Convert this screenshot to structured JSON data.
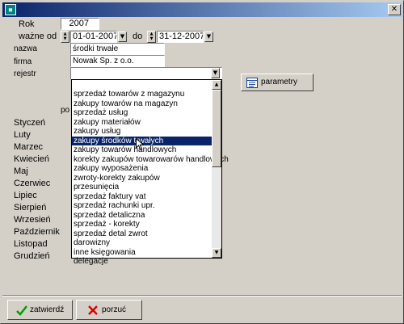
{
  "titlebar": {
    "icon": "app-icon",
    "close": "✕"
  },
  "form": {
    "rok_label": "Rok",
    "rok_value": "2007",
    "wazne_od_label": "ważne od",
    "date_from": "01-01-2007",
    "do_label": "do",
    "date_to": "31-12-2007",
    "nazwa_label": "nazwa",
    "nazwa_value": "środki trwałe",
    "firma_label": "firma",
    "firma_value": "Nowak Sp. z o.o.",
    "rejestr_label": "rejestr",
    "rejestr_value": "",
    "partial_label": "po"
  },
  "parametry_button": {
    "label": "parametry",
    "icon": "table-settings-icon"
  },
  "months": [
    "Styczeń",
    "Luty",
    "Marzec",
    "Kwiecień",
    "Maj",
    "Czerwiec",
    "Lipiec",
    "Sierpień",
    "Wrzesień",
    "Październik",
    "Listopad",
    "Grudzień"
  ],
  "dropdown": {
    "selected_index": 5,
    "items": [
      "sprzedaż towarów z magazynu",
      "zakupy towarów na magazyn",
      "sprzedaż usług",
      "zakupy materiałów",
      "zakupy usług",
      "zakupy środków trwałych",
      "zakupy towarów handlowych",
      "korekty zakupów towarowarów handlowych",
      "zakupy wyposażenia",
      "zwroty-korekty zakupów",
      "przesunięcia",
      "sprzedaż faktury vat",
      "sprzedaż rachunki upr.",
      "sprzedaż detaliczna",
      "sprzedaż - korekty",
      "sprzedaż detal zwrot",
      "darowizny",
      "inne księgowania",
      "delegacje"
    ]
  },
  "footer": {
    "confirm_label": "zatwierdź",
    "cancel_label": "porzuć",
    "colors": {
      "confirm_icon": "#00a000",
      "cancel_icon": "#e00000"
    }
  }
}
